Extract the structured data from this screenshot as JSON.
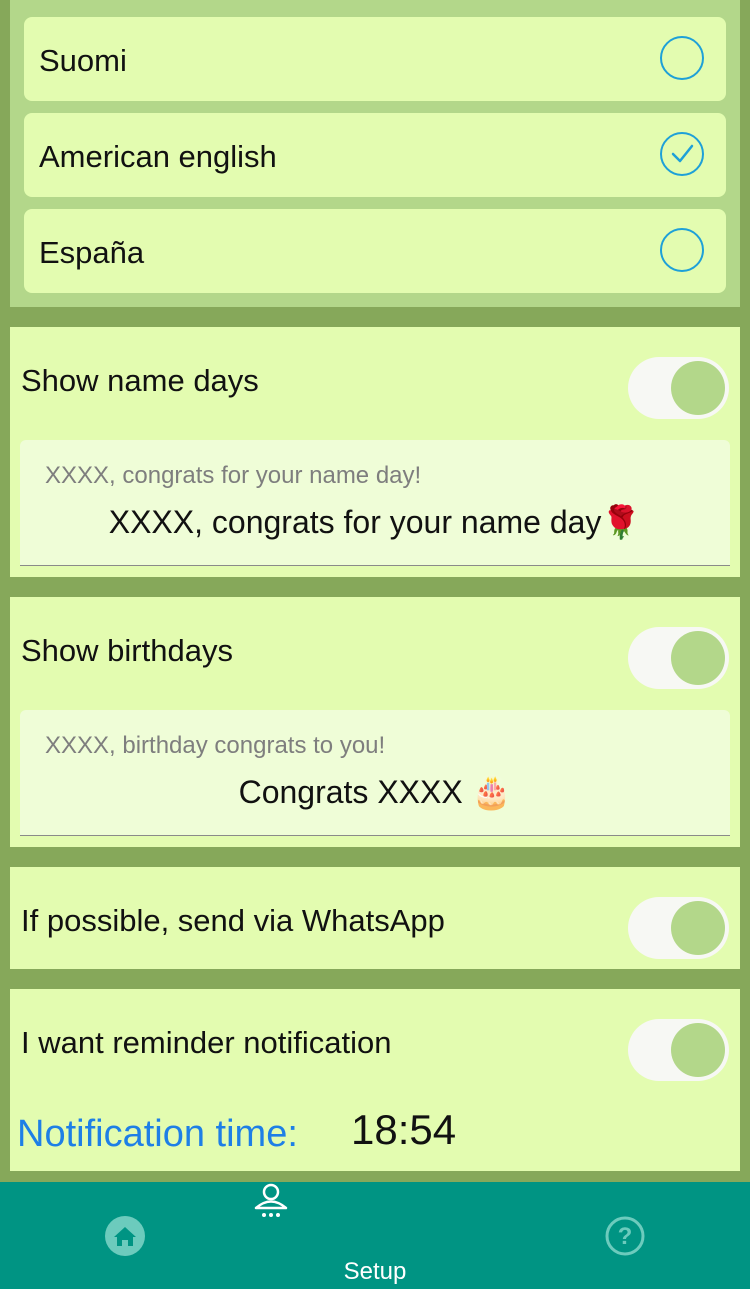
{
  "languages": [
    {
      "label": "Suomi",
      "selected": false
    },
    {
      "label": "American english",
      "selected": true
    },
    {
      "label": "España",
      "selected": false
    }
  ],
  "name_days": {
    "label": "Show name days",
    "enabled": true,
    "placeholder": "XXXX, congrats for your name day!",
    "value": "XXXX, congrats for your name day🌹"
  },
  "birthdays": {
    "label": "Show birthdays",
    "enabled": true,
    "placeholder": "XXXX, birthday congrats to you!",
    "value": "Congrats XXXX 🎂"
  },
  "whatsapp": {
    "label": "If possible, send via WhatsApp",
    "enabled": true
  },
  "reminder": {
    "label": "I want reminder notification",
    "enabled": true,
    "time_label": "Notification time:",
    "time_value": "18:54"
  },
  "tabbar": {
    "tabs": [
      {
        "icon": "home-icon",
        "label": ""
      },
      {
        "icon": "user-setup-icon",
        "label": "Setup"
      },
      {
        "icon": "help-icon",
        "label": ""
      }
    ]
  },
  "colors": {
    "background": "#86a85a",
    "panel": "#e3fcb0",
    "accent_blue": "#1ea0d8",
    "toggle_knob": "#b3d78a",
    "tabbar": "#009483"
  }
}
